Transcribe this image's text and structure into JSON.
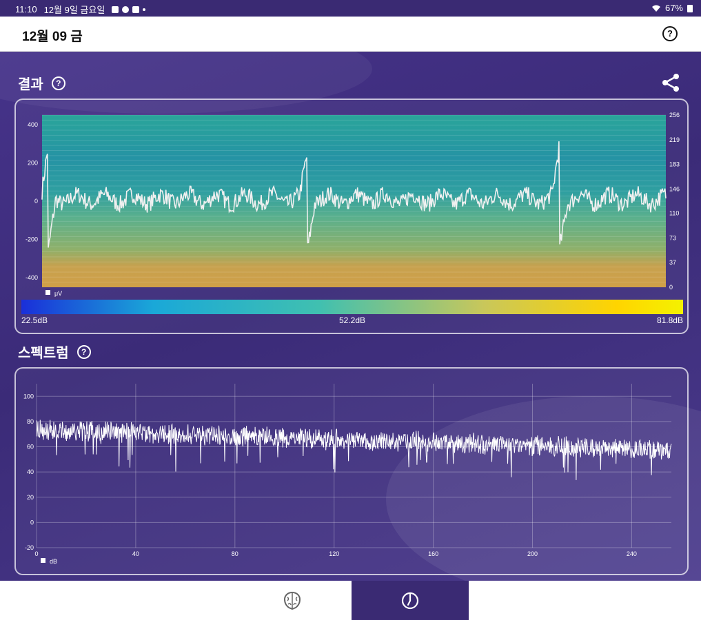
{
  "status_bar": {
    "time": "11:10",
    "date": "12월 9일 금요일",
    "battery": "67%"
  },
  "header": {
    "title": "12월 09 금"
  },
  "result": {
    "title": "결과",
    "y_ticks_left": [
      "400",
      "200",
      "0",
      "-200",
      "-400"
    ],
    "y_ticks_right": [
      "256",
      "219",
      "183",
      "146",
      "110",
      "73",
      "37",
      "0"
    ],
    "legend": "μV",
    "colorbar": {
      "min": "22.5dB",
      "mid": "52.2dB",
      "max": "81.8dB"
    }
  },
  "spectrum": {
    "title": "스펙트럼",
    "legend": "dB"
  },
  "colors": {
    "background": "#3f2d7a",
    "card_border": "#d6cff0",
    "accent_dark": "#3a2a73",
    "colorbar_stops": [
      "#1a2fd9",
      "#1aa8d8",
      "#55c8a0",
      "#d6c94a",
      "#ffd400",
      "#f2f200"
    ]
  },
  "chart_data": [
    {
      "type": "line",
      "title": "",
      "ylim": [
        -450,
        450
      ],
      "y_ticks": [
        -400,
        -200,
        0,
        200,
        400
      ],
      "y2_ticks": [
        0,
        37,
        73,
        110,
        146,
        183,
        219,
        256
      ],
      "series": [
        {
          "name": "μV",
          "kind": "eeg_waveform"
        }
      ],
      "notes": "raw EEG trace overlaid on spectrogram heatmap"
    },
    {
      "type": "line",
      "title": "",
      "xlim": [
        0,
        256
      ],
      "ylim": [
        -20,
        110
      ],
      "x_ticks": [
        0,
        40,
        80,
        120,
        160,
        200,
        240
      ],
      "y_ticks": [
        -20,
        0,
        20,
        40,
        60,
        80,
        100
      ],
      "series": [
        {
          "name": "dB",
          "approx_values": {
            "start": 80,
            "end": 62
          }
        }
      ]
    }
  ]
}
